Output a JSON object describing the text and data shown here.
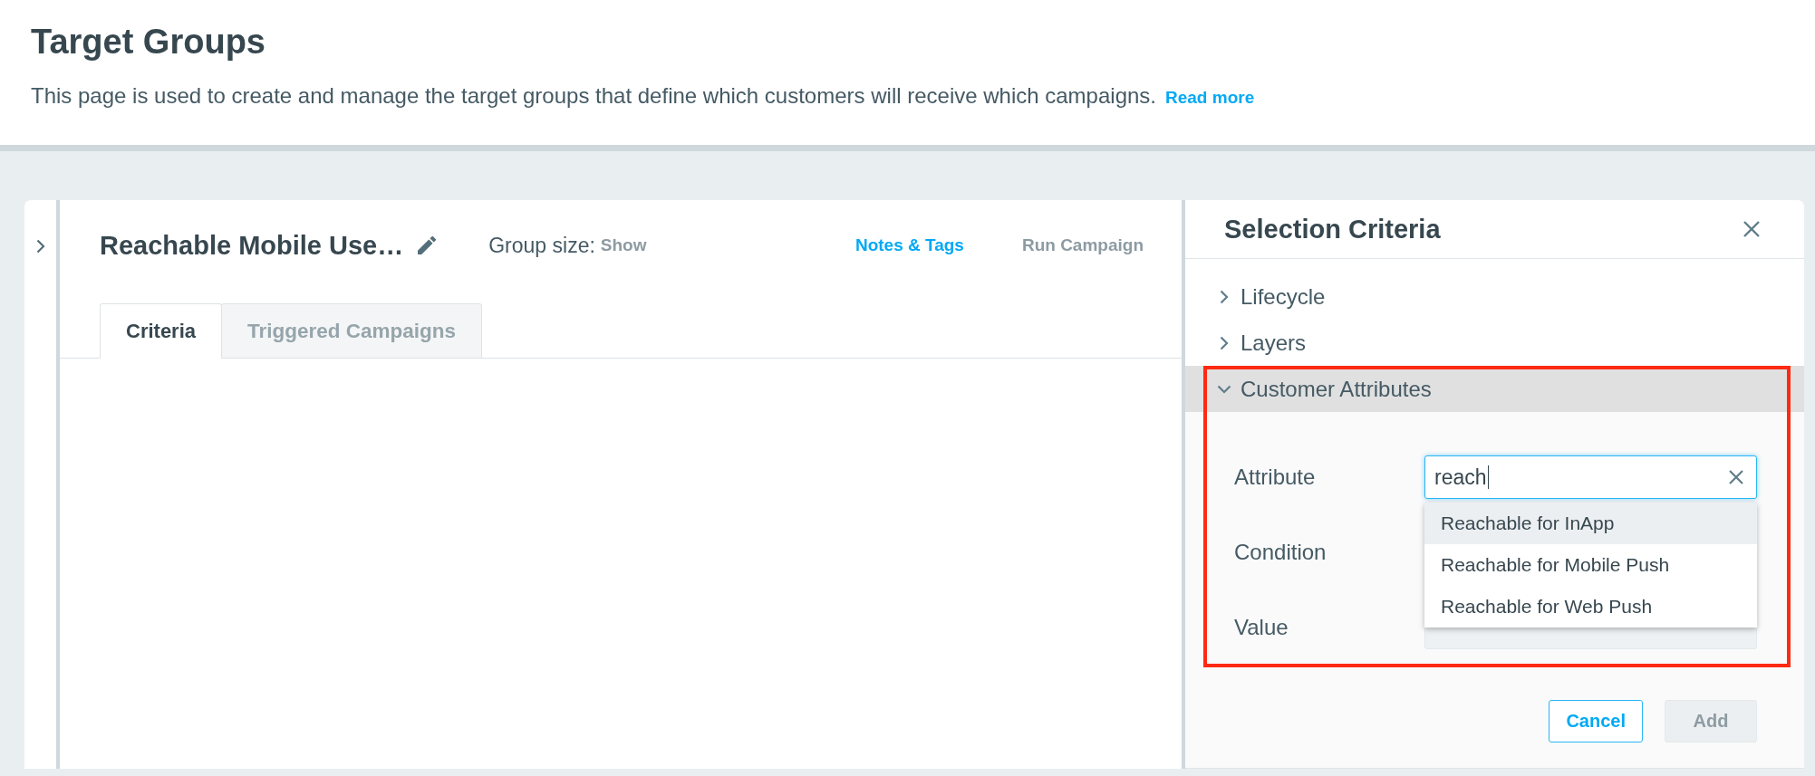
{
  "page_header": {
    "title": "Target Groups",
    "description": "This page is used to create and manage the target groups that define which customers will receive which campaigns.",
    "link": "Read more"
  },
  "group_panel": {
    "title": "Reachable Mobile Use…",
    "size_label": "Group size:",
    "size_link": {
      "label": "Show",
      "disabled": true
    },
    "actions": [
      {
        "label": "Notes & Tags",
        "disabled": false
      },
      {
        "label": "Run Campaign",
        "disabled": true
      }
    ],
    "tabs": [
      {
        "label": "Criteria",
        "selected": true
      },
      {
        "label": "Triggered Campaigns",
        "selected": false
      }
    ]
  },
  "selection_panel": {
    "title": "Selection Criteria",
    "categories": [
      {
        "label": "Lifecycle",
        "expanded": false,
        "highlighted": false
      },
      {
        "label": "Layers",
        "expanded": false,
        "highlighted": false
      },
      {
        "label": "Customer Attributes",
        "expanded": true,
        "highlighted": true,
        "fields": [
          {
            "label": "Attribute",
            "input": {
              "value": "reach",
              "focused": true,
              "disabled": false,
              "suggestions": [
                {
                  "label": "Reachable for InApp",
                  "selected": true
                },
                {
                  "label": "Reachable for Mobile Push",
                  "selected": false
                },
                {
                  "label": "Reachable for Web Push",
                  "selected": false
                }
              ]
            }
          },
          {
            "label": "Condition"
          },
          {
            "label": "Value",
            "input": {
              "focused": false,
              "disabled": true
            }
          }
        ]
      }
    ],
    "buttons": [
      {
        "label": "Cancel",
        "disabled": false
      },
      {
        "label": "Add",
        "disabled": true
      }
    ]
  }
}
